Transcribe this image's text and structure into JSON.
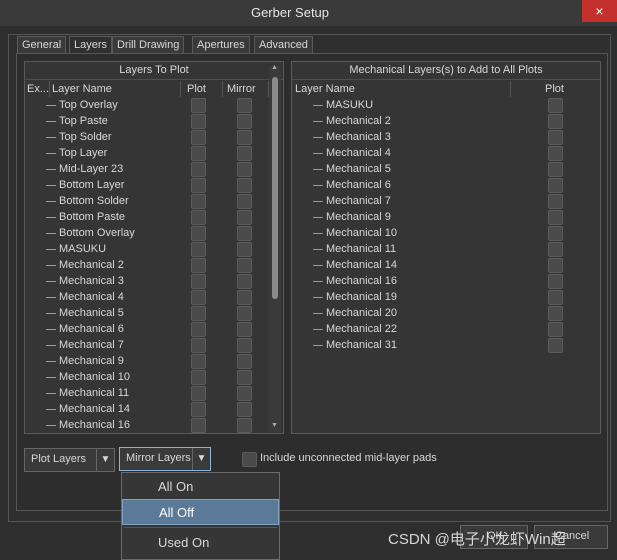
{
  "window": {
    "title": "Gerber Setup",
    "close_glyph": "×"
  },
  "tabs": [
    {
      "label": "General",
      "active": false
    },
    {
      "label": "Layers",
      "active": true
    },
    {
      "label": "Drill Drawing",
      "active": false
    },
    {
      "label": "Apertures",
      "active": false
    },
    {
      "label": "Advanced",
      "active": false
    }
  ],
  "layers_to_plot": {
    "title": "Layers To Plot",
    "columns": {
      "expand": "Ex...",
      "name": "Layer Name",
      "plot": "Plot",
      "mirror": "Mirror"
    },
    "rows": [
      "Top Overlay",
      "Top Paste",
      "Top Solder",
      "Top Layer",
      "Mid-Layer 23",
      "Bottom Layer",
      "Bottom Solder",
      "Bottom Paste",
      "Bottom Overlay",
      "MASUKU",
      "Mechanical 2",
      "Mechanical 3",
      "Mechanical 4",
      "Mechanical 5",
      "Mechanical 6",
      "Mechanical 7",
      "Mechanical 9",
      "Mechanical 10",
      "Mechanical 11",
      "Mechanical 14",
      "Mechanical 16"
    ]
  },
  "mechanical_layers": {
    "title": "Mechanical Layers(s) to Add to All Plots",
    "columns": {
      "name": "Layer Name",
      "plot": "Plot"
    },
    "rows": [
      "MASUKU",
      "Mechanical 2",
      "Mechanical 3",
      "Mechanical 4",
      "Mechanical 5",
      "Mechanical 6",
      "Mechanical 7",
      "Mechanical 9",
      "Mechanical 10",
      "Mechanical 11",
      "Mechanical 14",
      "Mechanical 16",
      "Mechanical 19",
      "Mechanical 20",
      "Mechanical 22",
      "Mechanical 31"
    ]
  },
  "buttons": {
    "plot_layers": "Plot Layers",
    "mirror_layers": "Mirror Layers",
    "ok": "OK",
    "cancel": "Cancel",
    "arrow_glyph": "▼"
  },
  "options": {
    "include_unconnected": "Include unconnected mid-layer pads"
  },
  "mirror_menu": {
    "items": [
      {
        "label": "All On",
        "selected": false
      },
      {
        "label": "All Off",
        "selected": true
      },
      {
        "label": "Used On",
        "selected": false
      }
    ]
  },
  "watermark": "CSDN @电子小龙虾Win超"
}
